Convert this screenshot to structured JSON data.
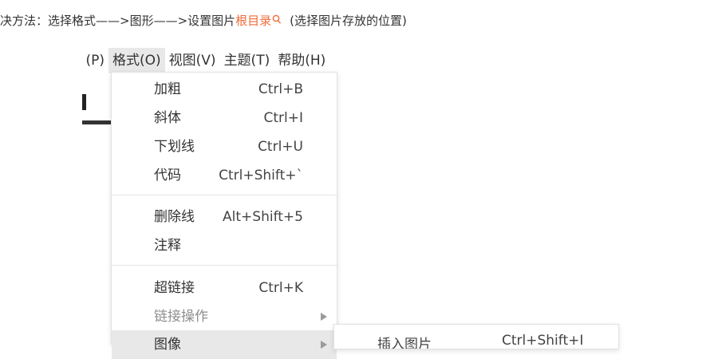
{
  "instruction": {
    "text": "决方法：选择格式——>图形——>设置图片",
    "link": "根目录",
    "note": "(选择图片存放的位置)",
    "link_color": "#f26b3a",
    "search_icon": "search-icon"
  },
  "menubar": {
    "items": [
      {
        "label": "(P)"
      },
      {
        "label": "格式(O)"
      },
      {
        "label": "视图(V)"
      },
      {
        "label": "主题(T)"
      },
      {
        "label": "帮助(H)"
      }
    ]
  },
  "format_menu": {
    "groups": [
      [
        {
          "label": "加粗",
          "shortcut": "Ctrl+B"
        },
        {
          "label": "斜体",
          "shortcut": "Ctrl+I"
        },
        {
          "label": "下划线",
          "shortcut": "Ctrl+U"
        },
        {
          "label": "代码",
          "shortcut": "Ctrl+Shift+`"
        }
      ],
      [
        {
          "label": "删除线",
          "shortcut": "Alt+Shift+5"
        },
        {
          "label": "注释",
          "shortcut": ""
        }
      ],
      [
        {
          "label": "超链接",
          "shortcut": "Ctrl+K"
        },
        {
          "label": "链接操作",
          "shortcut": "",
          "disabled": true,
          "submenu_arrow": true
        },
        {
          "label": "图像",
          "shortcut": "",
          "highlighted": true,
          "submenu_arrow": true
        }
      ]
    ]
  },
  "image_submenu": {
    "items": [
      {
        "label": "插入图片",
        "shortcut": "Ctrl+Shift+I"
      }
    ]
  }
}
